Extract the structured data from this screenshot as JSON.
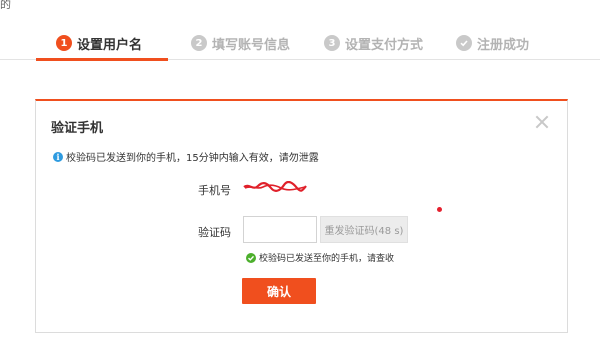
{
  "corner_text": "的",
  "steps": [
    {
      "num": "1",
      "label": "设置用户名",
      "state": "active"
    },
    {
      "num": "2",
      "label": "填写账号信息",
      "state": "inactive"
    },
    {
      "num": "3",
      "label": "设置支付方式",
      "state": "inactive"
    },
    {
      "num": "",
      "icon": "check-circle-icon",
      "label": "注册成功",
      "state": "inactive"
    }
  ],
  "dialog": {
    "title": "验证手机",
    "close_icon": "close-icon",
    "info_icon": "info-icon",
    "info_text": "校验码已发送到你的手机，15分钟内输入有效，请勿泄露",
    "phone_label": "手机号",
    "phone_value": "*************",
    "code_label": "验证码",
    "code_value": "",
    "resend_label": "重发验证码(48 s)",
    "sent_icon": "check-circle-icon",
    "sent_text": "校验码已发送至你的手机，请查收",
    "confirm_label": "确认"
  },
  "colors": {
    "accent": "#f04f1e",
    "info": "#2e9be0",
    "success": "#4caf2c",
    "inactive": "#c9c9c9"
  }
}
